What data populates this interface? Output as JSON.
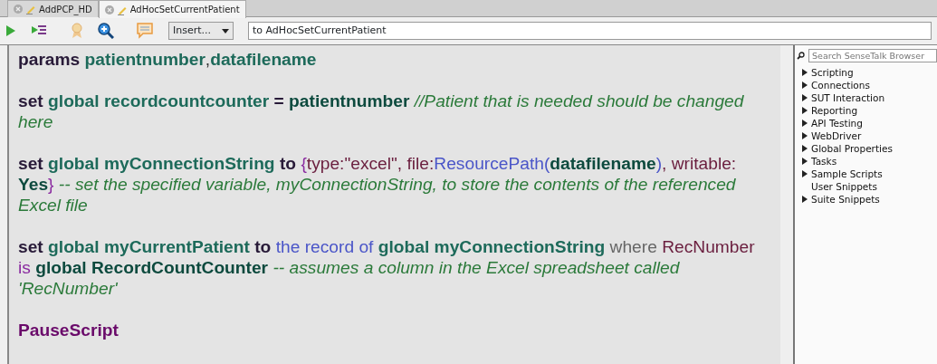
{
  "tabs": [
    {
      "label": "AddPCP_HD",
      "selected": false
    },
    {
      "label": "AdHocSetCurrentPatient",
      "selected": true
    }
  ],
  "toolbar": {
    "insert_dropdown": "Insert...",
    "handler_field": "to AdHocSetCurrentPatient"
  },
  "code_statements": [
    {
      "lines": [
        [
          {
            "kind": "command",
            "text": "params "
          },
          {
            "kind": "variable",
            "text": "patientnumber"
          },
          {
            "kind": "plain",
            "text": ","
          },
          {
            "kind": "variable",
            "text": "datafilename"
          }
        ]
      ]
    },
    {
      "lines": [
        [
          {
            "kind": "command",
            "text": "set "
          },
          {
            "kind": "variable",
            "text": "global recordcountcounter "
          },
          {
            "kind": "command",
            "text": "= "
          },
          {
            "kind": "name",
            "text": "patientnumber "
          },
          {
            "kind": "comment",
            "text": "//Patient that is needed should be changed"
          }
        ],
        [
          {
            "kind": "comment",
            "text": "here"
          }
        ]
      ]
    },
    {
      "lines": [
        [
          {
            "kind": "command",
            "text": "set "
          },
          {
            "kind": "variable",
            "text": "global myConnectionString "
          },
          {
            "kind": "command",
            "text": "to "
          },
          {
            "kind": "brace",
            "text": "{"
          },
          {
            "kind": "string",
            "text": "type:\"excel\", file:"
          },
          {
            "kind": "function",
            "text": "ResourcePath("
          },
          {
            "kind": "name",
            "text": "datafilename"
          },
          {
            "kind": "function",
            "text": ")"
          },
          {
            "kind": "string",
            "text": ", writable:"
          }
        ],
        [
          {
            "kind": "name",
            "text": "Yes"
          },
          {
            "kind": "brace",
            "text": "} "
          },
          {
            "kind": "comment",
            "text": "-- set the specified variable, myConnectionString, to store the contents of the referenced"
          }
        ],
        [
          {
            "kind": "comment",
            "text": "Excel file"
          }
        ]
      ]
    },
    {
      "lines": [
        [
          {
            "kind": "command",
            "text": "set "
          },
          {
            "kind": "variable",
            "text": "global myCurrentPatient "
          },
          {
            "kind": "command",
            "text": "to "
          },
          {
            "kind": "function",
            "text": "the record of "
          },
          {
            "kind": "variable",
            "text": "global myConnectionString "
          },
          {
            "kind": "gray",
            "text": "where "
          },
          {
            "kind": "string",
            "text": "RecNumber"
          }
        ],
        [
          {
            "kind": "brace",
            "text": "is "
          },
          {
            "kind": "name",
            "text": "global RecordCountCounter "
          },
          {
            "kind": "comment",
            "text": "-- assumes a column in the Excel spreadsheet called"
          }
        ],
        [
          {
            "kind": "comment",
            "text": "'RecNumber'"
          }
        ]
      ]
    },
    {
      "lines": [
        [
          {
            "kind": "handler",
            "text": "PauseScript"
          }
        ]
      ]
    }
  ],
  "browser": {
    "search_placeholder": "Search SenseTalk Browser",
    "items": [
      {
        "label": "Scripting",
        "expandable": true
      },
      {
        "label": "Connections",
        "expandable": true
      },
      {
        "label": "SUT Interaction",
        "expandable": true
      },
      {
        "label": "Reporting",
        "expandable": true
      },
      {
        "label": "API Testing",
        "expandable": true
      },
      {
        "label": "WebDriver",
        "expandable": true
      },
      {
        "label": "Global Properties",
        "expandable": true
      },
      {
        "label": "Tasks",
        "expandable": true
      },
      {
        "label": "Sample Scripts",
        "expandable": true
      },
      {
        "label": "User Snippets",
        "expandable": false
      },
      {
        "label": "Suite Snippets",
        "expandable": true
      }
    ]
  }
}
